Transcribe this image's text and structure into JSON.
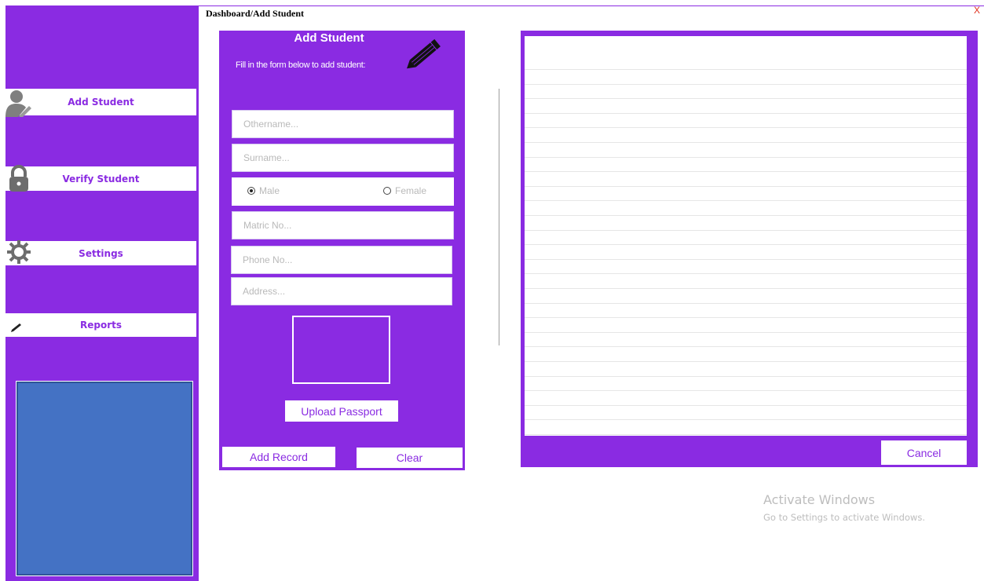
{
  "title": "Dashboard/Add Student",
  "close_label": "X",
  "sidebar": {
    "items": [
      {
        "label": "Add Student",
        "icon": "user-edit-icon"
      },
      {
        "label": "Verify Student",
        "icon": "lock-icon"
      },
      {
        "label": "Settings",
        "icon": "gear-icon"
      },
      {
        "label": "Reports",
        "icon": "pen-icon"
      }
    ]
  },
  "form": {
    "title": "Add Student",
    "subtitle": "Fill in the form below to add student:",
    "othername_placeholder": "Othername...",
    "surname_placeholder": "Surname...",
    "gender": {
      "male": "Male",
      "female": "Female",
      "selected": "Male"
    },
    "matric_placeholder": "Matric No...",
    "phone_placeholder": "Phone No...",
    "address_placeholder": "Address...",
    "upload_label": "Upload Passport",
    "add_label": "Add Record",
    "clear_label": "Clear"
  },
  "records": {
    "cancel_label": "Cancel"
  },
  "watermark": {
    "title": "Activate Windows",
    "subtitle": "Go to Settings to activate Windows."
  },
  "colors": {
    "accent": "#8a2be2",
    "panel_blue": "#4472c4",
    "icon_gray": "#7f7f7f"
  }
}
